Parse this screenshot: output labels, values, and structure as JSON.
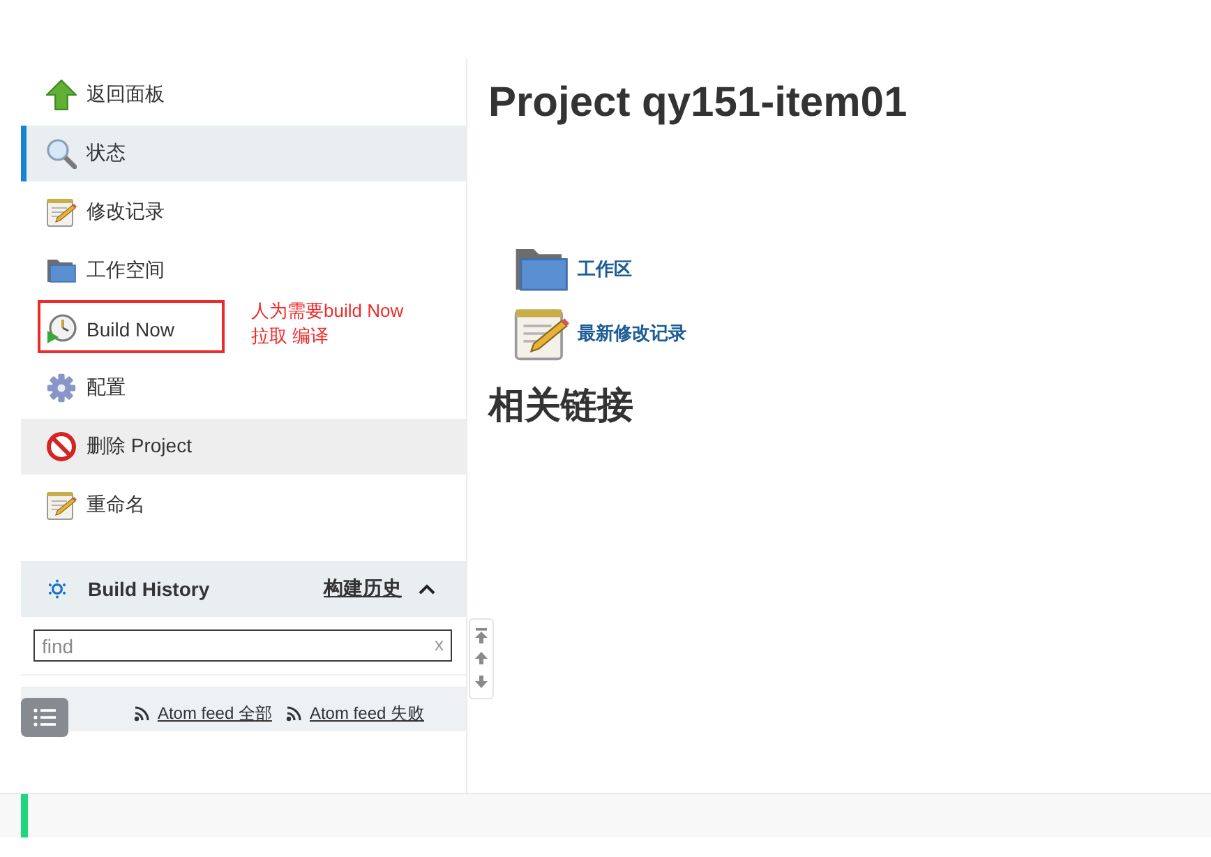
{
  "sidebar": {
    "items": [
      {
        "label": "返回面板",
        "selected": false,
        "hovered": false
      },
      {
        "label": "状态",
        "selected": true,
        "hovered": false
      },
      {
        "label": "修改记录",
        "selected": false,
        "hovered": false
      },
      {
        "label": "工作空间",
        "selected": false,
        "hovered": false
      },
      {
        "label": "Build Now",
        "selected": false,
        "hovered": false,
        "annotation": {
          "lines": [
            "人为需要build Now",
            "拉取 编译"
          ]
        }
      },
      {
        "label": "配置",
        "selected": false,
        "hovered": false
      },
      {
        "label": "删除 Project",
        "selected": false,
        "hovered": true
      },
      {
        "label": "重命名",
        "selected": false,
        "hovered": false
      }
    ]
  },
  "build_history": {
    "title": "Build History",
    "link": "构建历史",
    "expanded": true,
    "search": {
      "placeholder": "find",
      "clear": "x"
    },
    "feeds": [
      "Atom feed 全部",
      "Atom feed 失败"
    ]
  },
  "main": {
    "title": "Project qy151-item01",
    "links": [
      "工作区",
      "最新修改记录"
    ],
    "section_title": "相关链接"
  }
}
